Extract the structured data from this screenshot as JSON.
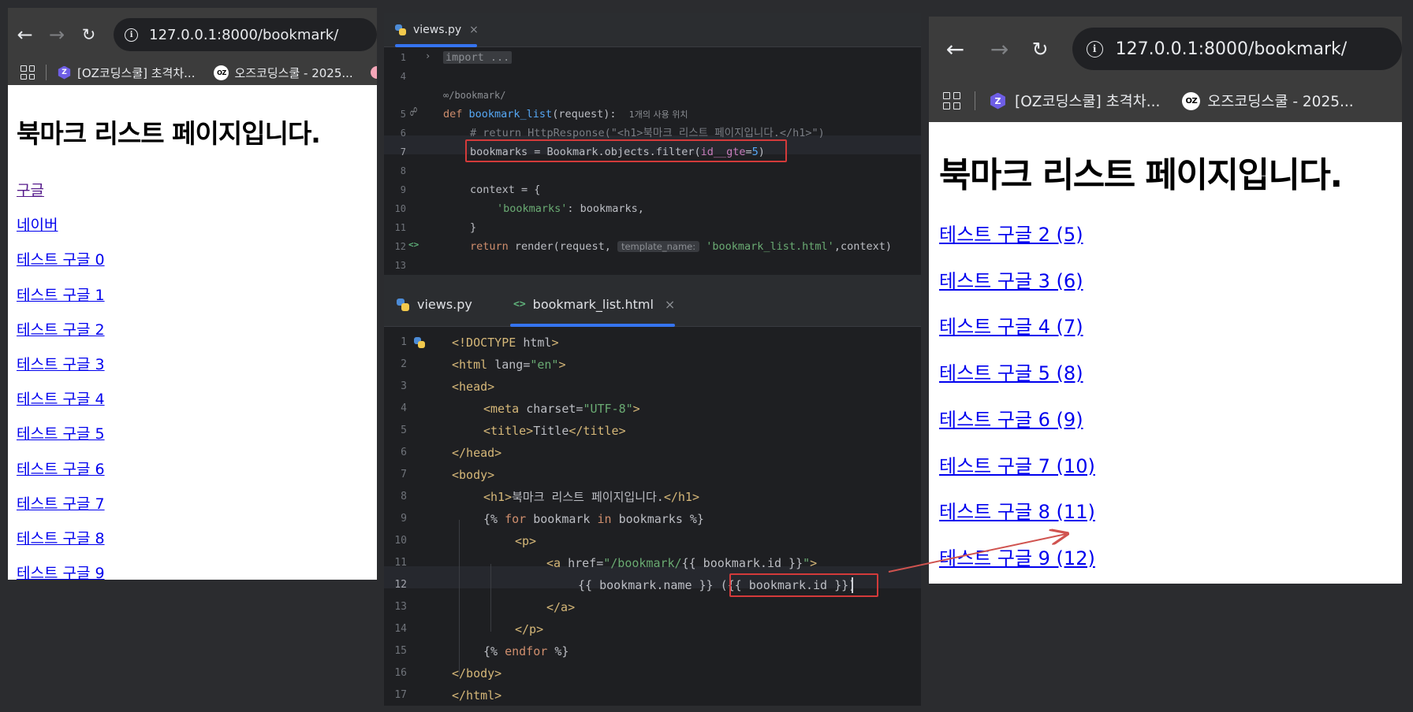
{
  "browser": {
    "url": "127.0.0.1:8000/bookmark/",
    "bookmark_1": "[OZ코딩스쿨] 초격차...",
    "bookmark_2": "오즈코딩스쿨 - 2025...",
    "favicon_z_glyph": "Z",
    "favicon_oz_glyph": "OZ"
  },
  "left_page": {
    "heading": "북마크 리스트 페이지입니다.",
    "links": [
      "구글",
      "네이버",
      "테스트 구글 0",
      "테스트 구글 1",
      "테스트 구글 2",
      "테스트 구글 3",
      "테스트 구글 4",
      "테스트 구글 5",
      "테스트 구글 6",
      "테스트 구글 7",
      "테스트 구글 8",
      "테스트 구글 9"
    ]
  },
  "right_page": {
    "heading": "북마크 리스트 페이지입니다.",
    "links": [
      "테스트 구글 2 (5)",
      "테스트 구글 3 (6)",
      "테스트 구글 4 (7)",
      "테스트 구글 5 (8)",
      "테스트 구글 6 (9)",
      "테스트 구글 7 (10)",
      "테스트 구글 8 (11)",
      "테스트 구글 9 (12)"
    ]
  },
  "views_editor": {
    "tab_label": "views.py",
    "line_numbers": [
      "1",
      "4",
      "5",
      "6",
      "7",
      "8",
      "9",
      "10",
      "11",
      "12",
      "13"
    ],
    "l1_fold": "import ...",
    "route_hint": "/bookmark/",
    "l5_def": "def ",
    "l5_fn": "bookmark_list",
    "l5_rest": "(request):",
    "l5_usage": "1개의 사용 위치",
    "l6_comment": "# return HttpResponse(\"<h1>북마크 리스트 페이지입니다.</h1>\")",
    "l7_code": "bookmarks = Bookmark.objects.filter(",
    "l7_param": "id__gte",
    "l7_eq": "=",
    "l7_num": "5",
    "l7_close": ")",
    "l9": "context = {",
    "l10_key": "'bookmarks'",
    "l10_rest": ": bookmarks,",
    "l11": "}",
    "l12_return": "return ",
    "l12_call": "render(request, ",
    "l12_hint": "template_name:",
    "l12_str": "'bookmark_list.html'",
    "l12_end": ",context)"
  },
  "template_editor": {
    "tab_1": "views.py",
    "tab_2": "bookmark_list.html",
    "tab_html_glyph": "<>",
    "line_numbers": [
      "1",
      "2",
      "3",
      "4",
      "5",
      "6",
      "7",
      "8",
      "9",
      "10",
      "11",
      "12",
      "13",
      "14",
      "15",
      "16",
      "17"
    ],
    "l1_a": "<!DOCTYPE ",
    "l1_b": "html",
    "l1_c": ">",
    "l2_a": "<html ",
    "l2_b": "lang",
    "l2_c": "=",
    "l2_d": "\"en\"",
    "l2_e": ">",
    "l3": "<head>",
    "l4_a": "<meta ",
    "l4_b": "charset",
    "l4_c": "=",
    "l4_d": "\"UTF-8\"",
    "l4_e": ">",
    "l5_a": "<title>",
    "l5_b": "Title",
    "l5_c": "</title>",
    "l6": "</head>",
    "l7": "<body>",
    "l8_a": "<h1>",
    "l8_b": "북마크 리스트 페이지입니다.",
    "l8_c": "</h1>",
    "l9_a": "{% ",
    "l9_b": "for ",
    "l9_c": "bookmark ",
    "l9_d": "in ",
    "l9_e": "bookmarks %}",
    "l10": "<p>",
    "l11_a": "<a ",
    "l11_b": "href",
    "l11_c": "=",
    "l11_d": "\"/bookmark/",
    "l11_e": "{{ bookmark.id }}",
    "l11_f": "\"",
    "l11_g": ">",
    "l12_a": "{{ bookmark.name }} ",
    "l12_b": "({{ bookmark.id }})",
    "l13": "</a>",
    "l14": "</p>",
    "l15_a": "{% ",
    "l15_b": "endfor ",
    "l15_c": "%}",
    "l16": "</body>",
    "l17": "</html>"
  },
  "colors": {
    "annotation_red": "#d33a3a",
    "link_blue": "#0000ee",
    "visited_purple": "#551a8b",
    "ide_background": "#1e1f22",
    "accent_blue": "#3574f0"
  }
}
